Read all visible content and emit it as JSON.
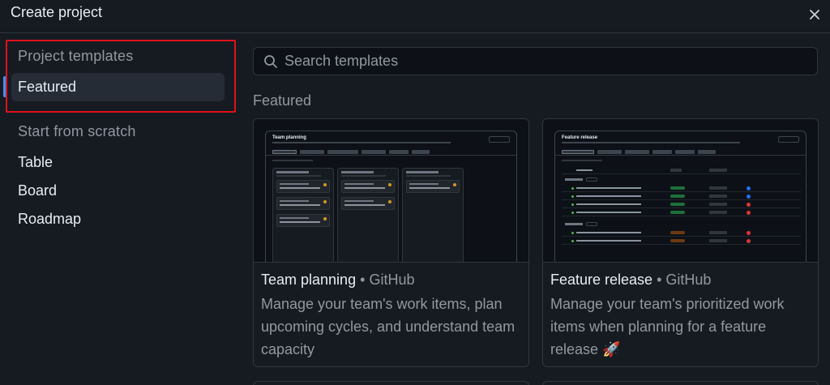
{
  "dialog": {
    "title": "Create project",
    "close_icon": "close-icon"
  },
  "sidebar": {
    "templates_heading": "Project templates",
    "featured_label": "Featured",
    "scratch_heading": "Start from scratch",
    "scratch_items": [
      "Table",
      "Board",
      "Roadmap"
    ]
  },
  "search": {
    "placeholder": "Search templates",
    "icon": "search-icon"
  },
  "section": {
    "title": "Featured"
  },
  "cards": [
    {
      "name": "Team planning",
      "separator": "•",
      "org": "GitHub",
      "description": "Manage your team's work items, plan upcoming cycles, and understand team capacity",
      "preview_title": "Team planning"
    },
    {
      "name": "Feature release",
      "separator": "•",
      "org": "GitHub",
      "description": "Manage your team's prioritized work items when planning for a feature release 🚀",
      "preview_title": "Feature release"
    }
  ],
  "colors": {
    "accent": "#4493f8",
    "highlight": "#e0111b",
    "bg": "#161b22"
  }
}
